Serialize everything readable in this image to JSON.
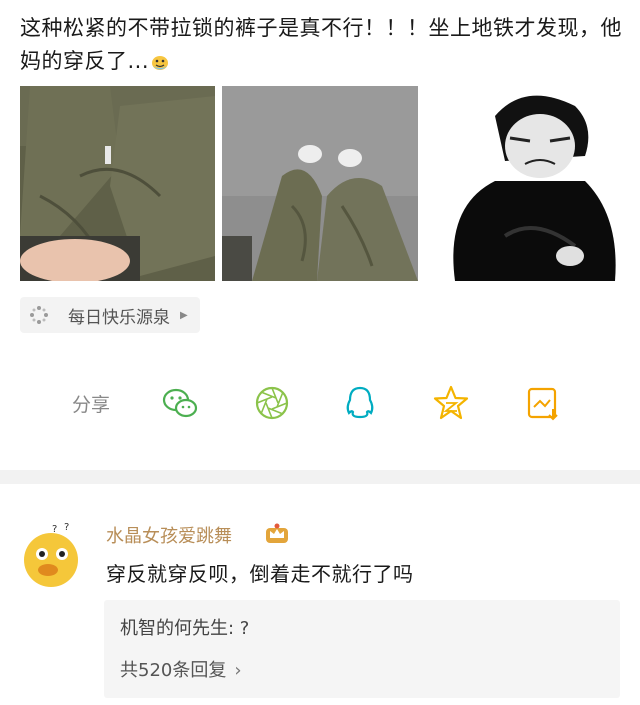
{
  "post": {
    "text": "这种松紧的不带拉锁的裤子是真不行！！！坐上地铁才发现，他妈的穿反了...",
    "emoji_icon": "crying-laughing-emoji-icon"
  },
  "images": [
    {
      "icon": "photo-pants-front"
    },
    {
      "icon": "photo-pants-sitting"
    },
    {
      "icon": "meme-cartoon-guy"
    }
  ],
  "tag": {
    "label": "每日快乐源泉",
    "icon": "sparkle-icon"
  },
  "share": {
    "label": "分享",
    "targets": [
      {
        "icon": "wechat-icon",
        "color": "#4caf50"
      },
      {
        "icon": "moments-icon",
        "color": "#8bc34a"
      },
      {
        "icon": "qq-icon",
        "color": "#00acc1"
      },
      {
        "icon": "qzone-star-icon",
        "color": "#f4b400"
      },
      {
        "icon": "weibo-save-icon",
        "color": "#f4a300"
      }
    ]
  },
  "comment": {
    "username": "水晶女孩爱跳舞",
    "badge_icon": "crown-badge-icon",
    "text": "穿反就穿反呗，倒着走不就行了吗",
    "reply_preview": "机智的何先生: ?",
    "reply_count": "共520条回复",
    "reply_chevron": "›"
  },
  "colors": {
    "username": "#b88e58",
    "divider": "#f2f2f2",
    "reply_bg": "#f5f5f5"
  }
}
